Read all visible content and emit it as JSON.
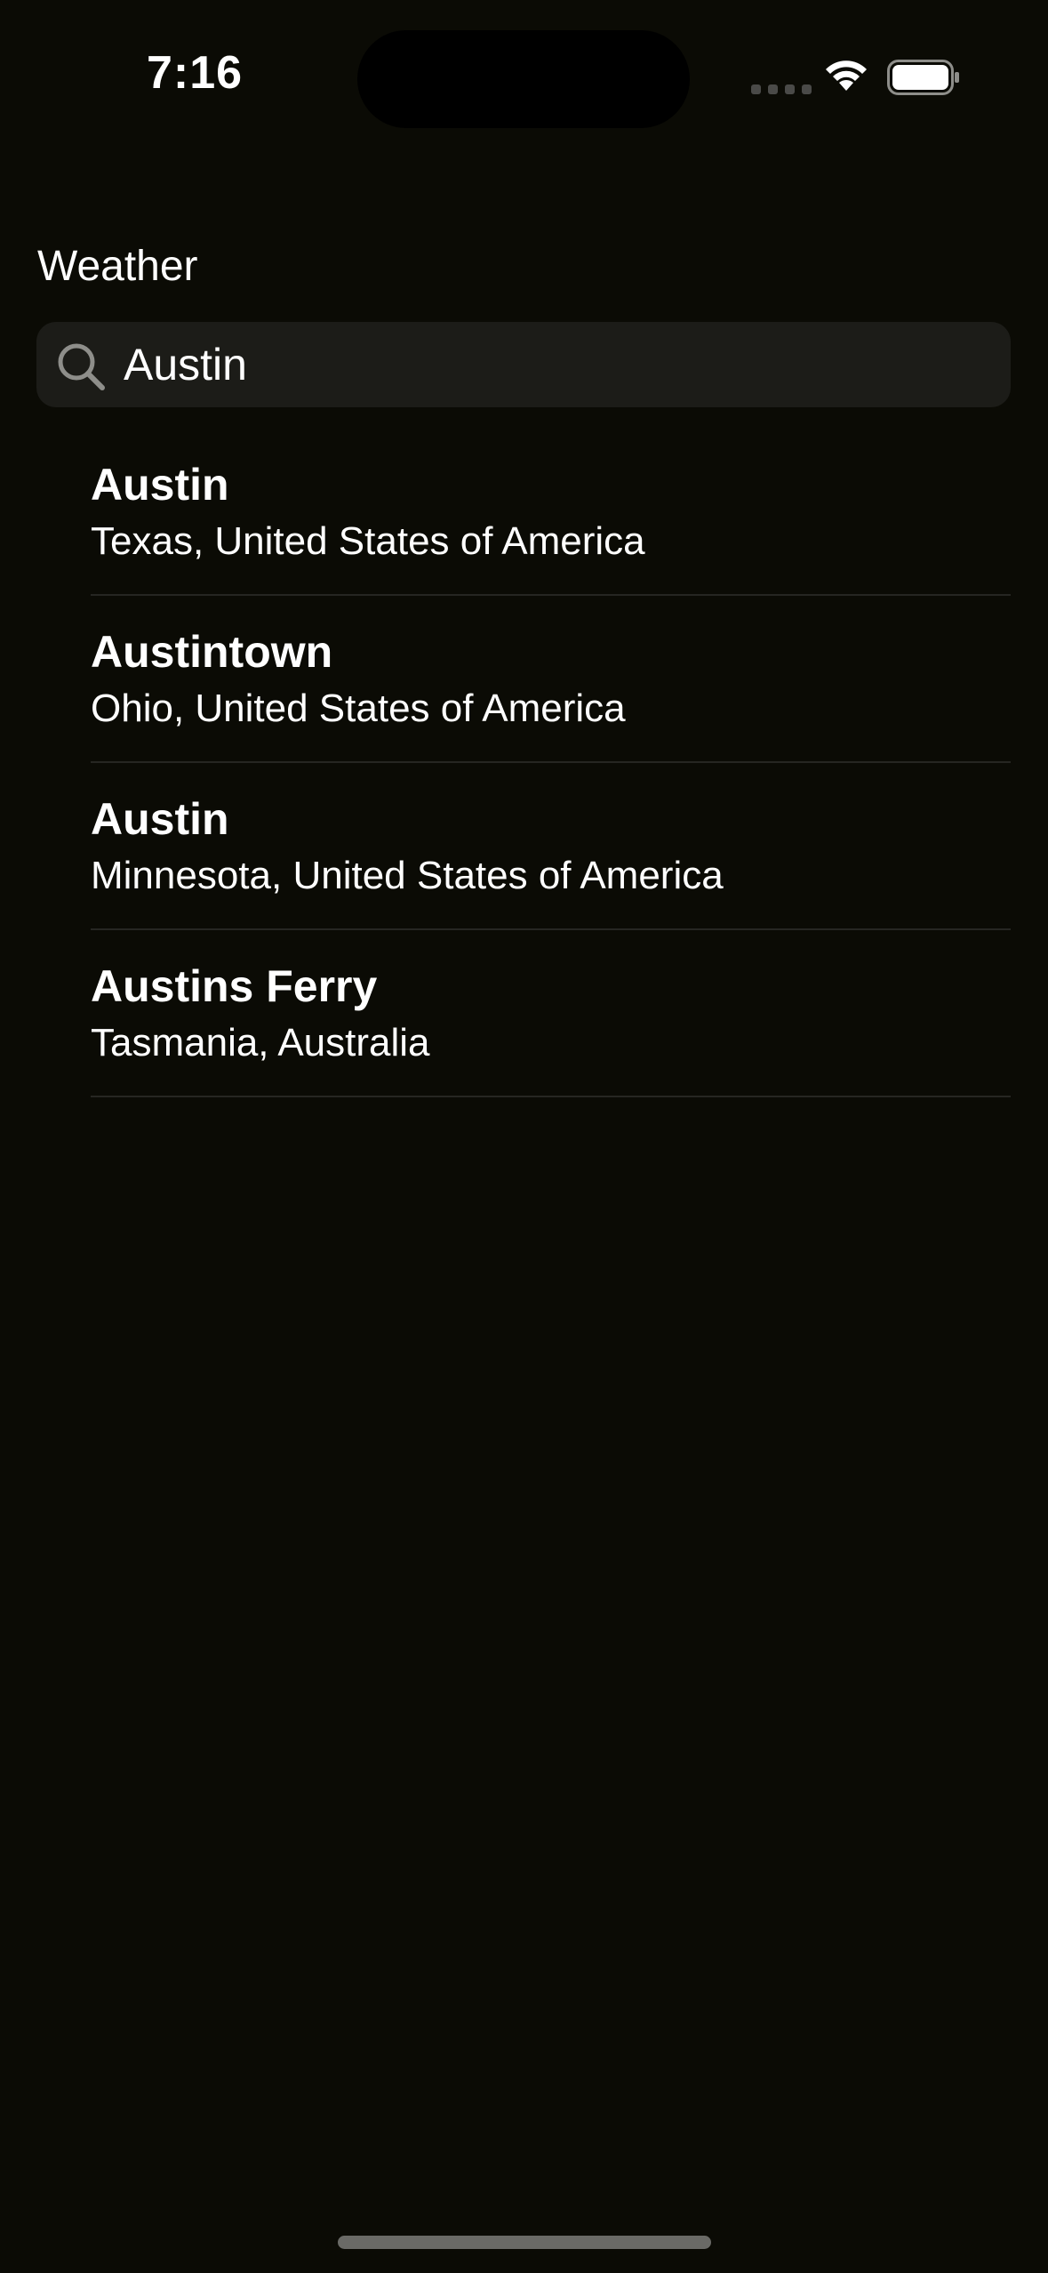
{
  "status_bar": {
    "time": "7:16",
    "icons": [
      "cellular-signal-icon",
      "wifi-icon",
      "battery-icon"
    ]
  },
  "header": {
    "title": "Weather"
  },
  "search": {
    "icon": "search-icon",
    "value": "Austin",
    "placeholder": ""
  },
  "results": [
    {
      "name": "Austin",
      "region": "Texas, United States of America"
    },
    {
      "name": "Austintown",
      "region": "Ohio, United States of America"
    },
    {
      "name": "Austin",
      "region": "Minnesota, United States of America"
    },
    {
      "name": "Austins Ferry",
      "region": "Tasmania, Australia"
    }
  ],
  "colors": {
    "background": "#0b0b05",
    "search_field": "#1c1c18",
    "text": "#ffffff",
    "icon_gray": "#8e8e8a",
    "divider": "#262622"
  }
}
